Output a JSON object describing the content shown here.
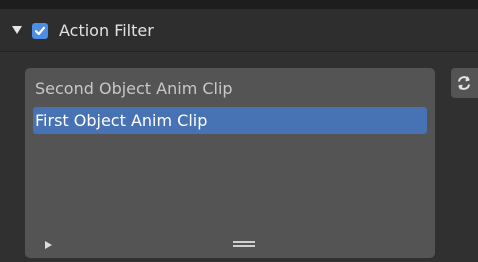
{
  "panel": {
    "title": "Action Filter",
    "enabled": true,
    "expanded": true
  },
  "action_list": {
    "items": [
      {
        "label": "Second Object Anim Clip",
        "selected": false
      },
      {
        "label": "First Object Anim Clip",
        "selected": true
      }
    ]
  },
  "icons": {
    "expand": "triangle-down-icon",
    "checkbox": "checkbox-checked-icon",
    "play": "triangle-right-icon",
    "grip": "resize-grip-icon",
    "refresh": "refresh-icon"
  },
  "colors": {
    "accent": "#4a8ee8",
    "selection": "#4772b3",
    "list_bg": "#545454",
    "header_bg": "#2e2e2e"
  }
}
